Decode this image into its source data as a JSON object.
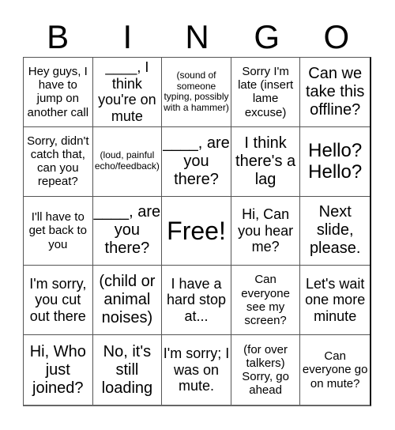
{
  "header": {
    "letters": [
      "B",
      "I",
      "N",
      "G",
      "O"
    ]
  },
  "cells": [
    {
      "text": "Hey guys, I have to jump on another call",
      "size": "s-sm"
    },
    {
      "text": "____, I think you're on mute",
      "size": "s-md"
    },
    {
      "text": "(sound of someone typing, possibly with a hammer)",
      "size": "s-xs"
    },
    {
      "text": "Sorry I'm late (insert lame excuse)",
      "size": "s-sm"
    },
    {
      "text": "Can we take this offline?",
      "size": "s-lg"
    },
    {
      "text": "Sorry, didn't catch that, can you repeat?",
      "size": "s-sm"
    },
    {
      "text": "(loud, painful echo/feedback)",
      "size": "s-xs"
    },
    {
      "text": "____, are you there?",
      "size": "s-lg"
    },
    {
      "text": "I think there's a lag",
      "size": "s-lg"
    },
    {
      "text": "Hello? Hello?",
      "size": "s-xl"
    },
    {
      "text": "I'll have to get back to you",
      "size": "s-sm"
    },
    {
      "text": "____, are you there?",
      "size": "s-lg"
    },
    {
      "text": "Free!",
      "size": "s-xxl"
    },
    {
      "text": "Hi, Can you hear me?",
      "size": "s-md"
    },
    {
      "text": "Next slide, please.",
      "size": "s-lg"
    },
    {
      "text": "I'm sorry, you cut out there",
      "size": "s-md"
    },
    {
      "text": "(child or animal noises)",
      "size": "s-lg"
    },
    {
      "text": "I have a hard stop at...",
      "size": "s-md"
    },
    {
      "text": "Can everyone see my screen?",
      "size": "s-sm"
    },
    {
      "text": "Let's wait one more minute",
      "size": "s-md"
    },
    {
      "text": "Hi, Who just joined?",
      "size": "s-lg"
    },
    {
      "text": "No, it's still loading",
      "size": "s-lg"
    },
    {
      "text": "I'm sorry; I was on mute.",
      "size": "s-md"
    },
    {
      "text": "(for over talkers) Sorry, go ahead",
      "size": "s-sm"
    },
    {
      "text": "Can everyone go on mute?",
      "size": "s-sm"
    }
  ]
}
